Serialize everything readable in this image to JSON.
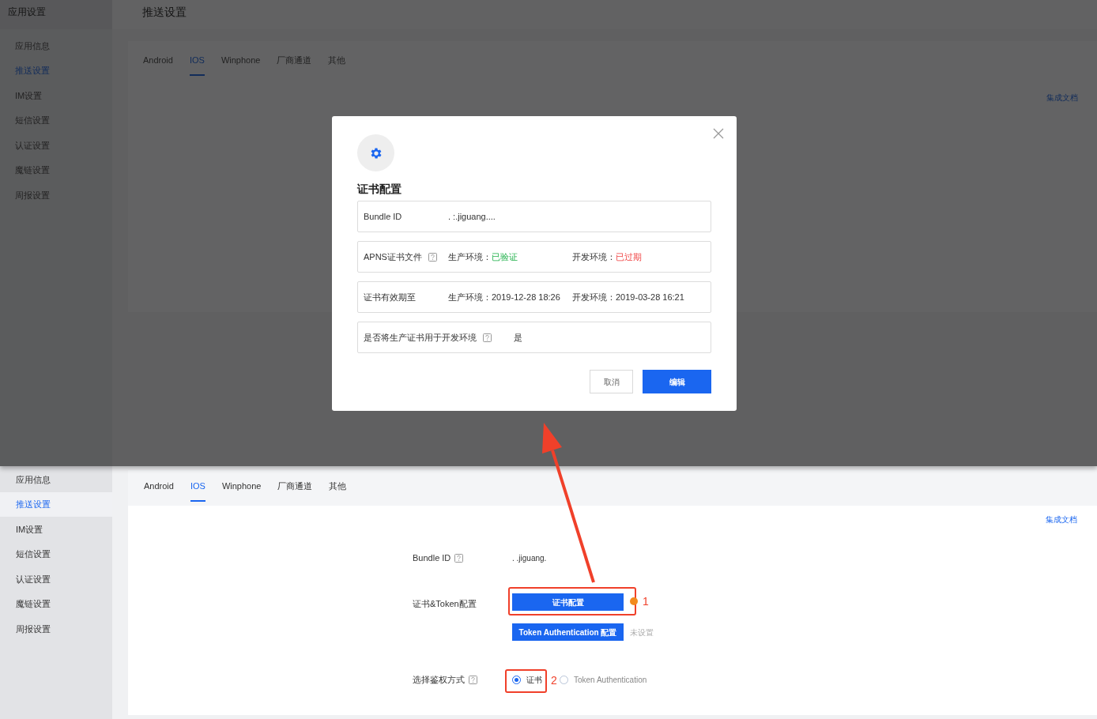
{
  "upper_view": {
    "app_title": "应用设置",
    "page_title": "推送设置",
    "sidebar": [
      {
        "label": "应用信息",
        "selected": false
      },
      {
        "label": "推送设置",
        "selected": true
      },
      {
        "label": "IM设置",
        "selected": false
      },
      {
        "label": "短信设置",
        "selected": false
      },
      {
        "label": "认证设置",
        "selected": false
      },
      {
        "label": "魔链设置",
        "selected": false
      },
      {
        "label": "周报设置",
        "selected": false
      }
    ],
    "tabs": [
      {
        "label": "Android",
        "selected": false
      },
      {
        "label": "IOS",
        "selected": true
      },
      {
        "label": "Winphone",
        "selected": false
      },
      {
        "label": "厂商通道",
        "selected": false
      },
      {
        "label": "其他",
        "selected": false
      }
    ],
    "docs_link": "集成文档"
  },
  "dialog": {
    "title": "证书配置",
    "rows": [
      {
        "label": "Bundle ID",
        "help": false,
        "values": [
          {
            "kind": "plain",
            "text": ". :.jiguang...."
          }
        ]
      },
      {
        "label": "APNS证书文件",
        "help": true,
        "values": [
          {
            "kind": "success",
            "prefix": "生产环境：",
            "text": "已验证"
          },
          {
            "kind": "danger",
            "prefix": "开发环境：",
            "text": "已过期"
          }
        ]
      },
      {
        "label": "证书有效期至",
        "help": false,
        "values": [
          {
            "kind": "plain",
            "prefix": "生产环境：",
            "text": "2019-12-28 18:26"
          },
          {
            "kind": "plain",
            "prefix": "开发环境：",
            "text": "2019-03-28 16:21"
          }
        ]
      },
      {
        "label": "是否将生产证书用于开发环境",
        "help": true,
        "values": [
          {
            "kind": "plain",
            "text": "是"
          }
        ]
      }
    ],
    "buttons": [
      {
        "label": "取消",
        "kind": "secondary"
      },
      {
        "label": "编辑",
        "kind": "primary"
      }
    ]
  },
  "lower_view": {
    "sidebar": [
      {
        "label": "应用信息",
        "selected": false
      },
      {
        "label": "推送设置",
        "selected": true
      },
      {
        "label": "IM设置",
        "selected": false
      },
      {
        "label": "短信设置",
        "selected": false
      },
      {
        "label": "认证设置",
        "selected": false
      },
      {
        "label": "魔链设置",
        "selected": false
      },
      {
        "label": "周报设置",
        "selected": false
      }
    ],
    "tabs": [
      {
        "label": "Android",
        "selected": false
      },
      {
        "label": "IOS",
        "selected": true
      },
      {
        "label": "Winphone",
        "selected": false
      },
      {
        "label": "厂商通道",
        "selected": false
      },
      {
        "label": "其他",
        "selected": false
      }
    ],
    "docs_link": "集成文档",
    "bundle_id": {
      "label": "Bundle ID",
      "value": ". .jiguang."
    },
    "config": {
      "label": "证书&Token配置",
      "cert_button": "证书配置",
      "token_button": "Token Authentication 配置",
      "token_status": "未设置"
    },
    "auth": {
      "label": "选择鉴权方式",
      "options": [
        {
          "label": "证书",
          "selected": true
        },
        {
          "label": "Token Authentication",
          "selected": false
        }
      ]
    }
  },
  "annotations": [
    {
      "label": "1"
    },
    {
      "label": "2"
    }
  ]
}
